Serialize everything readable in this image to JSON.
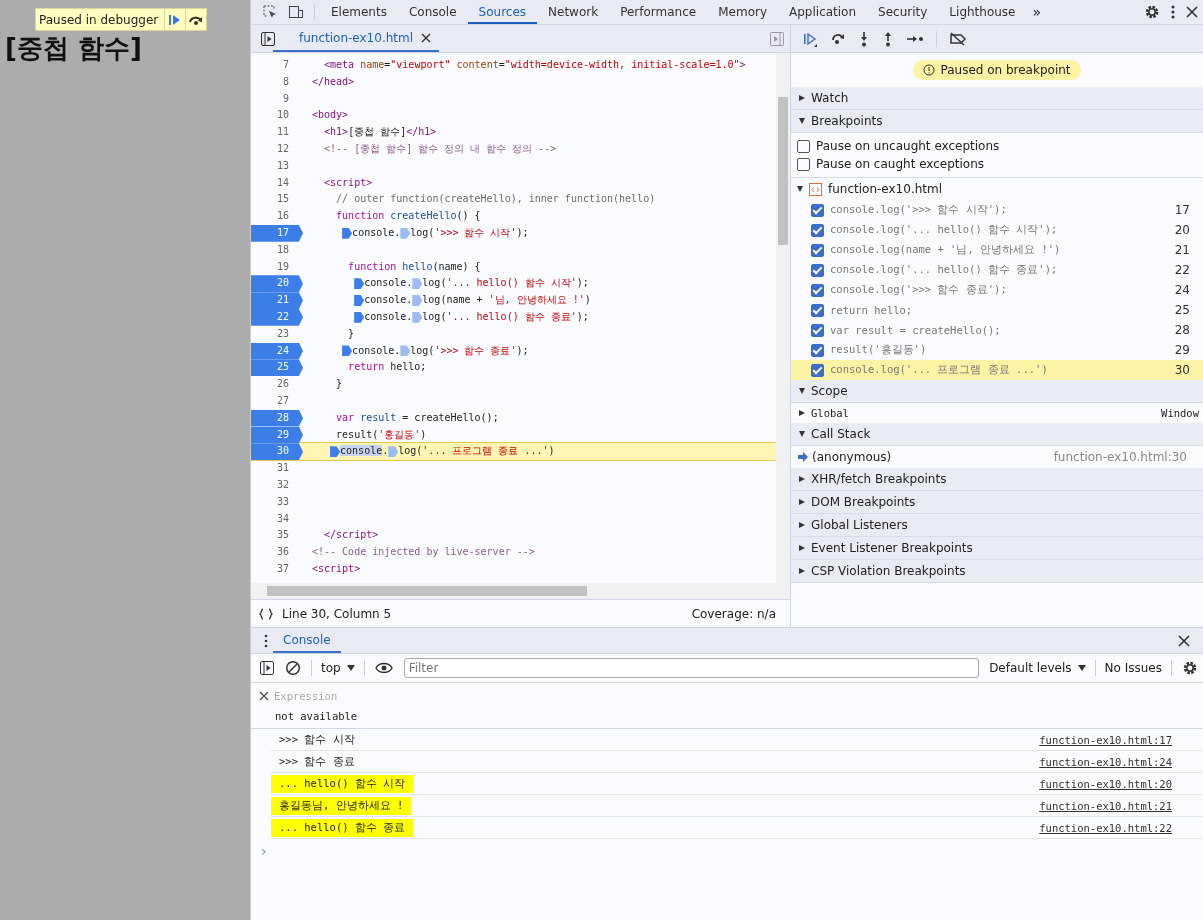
{
  "page": {
    "heading": "[중첩 함수]",
    "debugger_tooltip": {
      "label": "Paused in debugger"
    }
  },
  "devtools": {
    "tabs": [
      {
        "label": "Elements",
        "selected": false
      },
      {
        "label": "Console",
        "selected": false
      },
      {
        "label": "Sources",
        "selected": true
      },
      {
        "label": "Network",
        "selected": false
      },
      {
        "label": "Performance",
        "selected": false
      },
      {
        "label": "Memory",
        "selected": false
      },
      {
        "label": "Application",
        "selected": false
      },
      {
        "label": "Security",
        "selected": false
      },
      {
        "label": "Lighthouse",
        "selected": false
      }
    ],
    "more_tabs": "»",
    "editor": {
      "file_tab": {
        "label": "function-ex10.html",
        "selected": true
      },
      "lines": [
        {
          "number": "7",
          "breakpoint": false,
          "current": false,
          "segments": [
            {
              "kind": "tag",
              "text": "  <meta"
            },
            {
              "kind": "attr",
              "text": " name"
            },
            {
              "kind": "plain",
              "text": "="
            },
            {
              "kind": "str",
              "text": "\"viewport\""
            },
            {
              "kind": "attr",
              "text": " content"
            },
            {
              "kind": "plain",
              "text": "="
            },
            {
              "kind": "str",
              "text": "\"width=device-width, initial-scale=1.0\""
            },
            {
              "kind": "tag",
              "text": ">"
            }
          ]
        },
        {
          "number": "8",
          "breakpoint": false,
          "current": false,
          "segments": [
            {
              "kind": "tag",
              "text": "</head>"
            }
          ]
        },
        {
          "number": "9",
          "breakpoint": false,
          "current": false
        },
        {
          "number": "10",
          "breakpoint": false,
          "current": false,
          "segments": [
            {
              "kind": "tag",
              "text": "<body>"
            }
          ]
        },
        {
          "number": "11",
          "breakpoint": false,
          "current": false,
          "segments": [
            {
              "kind": "tag",
              "text": "  <h1>"
            },
            {
              "kind": "plain",
              "text": "[중첩 함수]"
            },
            {
              "kind": "tag",
              "text": "</h1>"
            }
          ]
        },
        {
          "number": "12",
          "breakpoint": false,
          "current": false,
          "segments": [
            {
              "kind": "cmt",
              "text": "  <!-- [중첩 함수] 함수 정의 내 함수 정의 -->"
            }
          ]
        },
        {
          "number": "13",
          "breakpoint": false,
          "current": false
        },
        {
          "number": "14",
          "breakpoint": false,
          "current": false,
          "segments": [
            {
              "kind": "tag",
              "text": "  <script>"
            }
          ]
        },
        {
          "number": "15",
          "breakpoint": false,
          "current": false,
          "segments": [
            {
              "kind": "jscmt",
              "text": "    // outer function(createHello), inner function(hello)"
            }
          ]
        },
        {
          "number": "16",
          "breakpoint": false,
          "current": false,
          "segments": [
            {
              "kind": "kw",
              "text": "    function"
            },
            {
              "kind": "def",
              "text": " createHello"
            },
            {
              "kind": "plain",
              "text": "() {"
            }
          ]
        },
        {
          "number": "17",
          "breakpoint": true,
          "current": false,
          "segments": [
            {
              "kind": "marker"
            },
            {
              "kind": "plain",
              "text": "     console."
            },
            {
              "kind": "marker-inactive"
            },
            {
              "kind": "plain",
              "text": "log("
            },
            {
              "kind": "str",
              "text": "'>>> 함수 시작'"
            },
            {
              "kind": "plain",
              "text": ");"
            }
          ]
        },
        {
          "number": "18",
          "breakpoint": false,
          "current": false
        },
        {
          "number": "19",
          "breakpoint": false,
          "current": false,
          "segments": [
            {
              "kind": "kw",
              "text": "      function"
            },
            {
              "kind": "def",
              "text": " hello"
            },
            {
              "kind": "plain",
              "text": "(name) {"
            }
          ]
        },
        {
          "number": "20",
          "breakpoint": true,
          "current": false,
          "segments": [
            {
              "kind": "marker"
            },
            {
              "kind": "plain",
              "text": "       console."
            },
            {
              "kind": "marker-inactive"
            },
            {
              "kind": "plain",
              "text": "log("
            },
            {
              "kind": "str",
              "text": "'... hello() 함수 시작'"
            },
            {
              "kind": "plain",
              "text": ");"
            }
          ]
        },
        {
          "number": "21",
          "breakpoint": true,
          "current": false,
          "segments": [
            {
              "kind": "marker"
            },
            {
              "kind": "plain",
              "text": "       console."
            },
            {
              "kind": "marker-inactive"
            },
            {
              "kind": "plain",
              "text": "log(name + "
            },
            {
              "kind": "str",
              "text": "'님, 안녕하세요 !'"
            },
            {
              "kind": "plain",
              "text": ")"
            }
          ]
        },
        {
          "number": "22",
          "breakpoint": true,
          "current": false,
          "segments": [
            {
              "kind": "marker"
            },
            {
              "kind": "plain",
              "text": "       console."
            },
            {
              "kind": "marker-inactive"
            },
            {
              "kind": "plain",
              "text": "log("
            },
            {
              "kind": "str",
              "text": "'... hello() 함수 종료'"
            },
            {
              "kind": "plain",
              "text": ");"
            }
          ]
        },
        {
          "number": "23",
          "breakpoint": false,
          "current": false,
          "segments": [
            {
              "kind": "plain",
              "text": "      }"
            }
          ]
        },
        {
          "number": "24",
          "breakpoint": true,
          "current": false,
          "segments": [
            {
              "kind": "marker"
            },
            {
              "kind": "plain",
              "text": "     console."
            },
            {
              "kind": "marker-inactive"
            },
            {
              "kind": "plain",
              "text": "log("
            },
            {
              "kind": "str",
              "text": "'>>> 함수 종료'"
            },
            {
              "kind": "plain",
              "text": ");"
            }
          ]
        },
        {
          "number": "25",
          "breakpoint": true,
          "current": false,
          "segments": [
            {
              "kind": "kw",
              "text": "      return"
            },
            {
              "kind": "plain",
              "text": " hello;"
            }
          ]
        },
        {
          "number": "26",
          "breakpoint": false,
          "current": false,
          "segments": [
            {
              "kind": "plain",
              "text": "    }"
            }
          ]
        },
        {
          "number": "27",
          "breakpoint": false,
          "current": false
        },
        {
          "number": "28",
          "breakpoint": true,
          "current": false,
          "segments": [
            {
              "kind": "kw",
              "text": "    var"
            },
            {
              "kind": "def",
              "text": " result"
            },
            {
              "kind": "plain",
              "text": " = createHello();"
            }
          ]
        },
        {
          "number": "29",
          "breakpoint": true,
          "current": false,
          "segments": [
            {
              "kind": "plain",
              "text": "    result("
            },
            {
              "kind": "str",
              "text": "'홍길동'"
            },
            {
              "kind": "plain",
              "text": ")"
            }
          ]
        },
        {
          "number": "30",
          "breakpoint": true,
          "current": true,
          "segments": [
            {
              "kind": "marker"
            },
            {
              "kind": "sel",
              "text": "   console"
            },
            {
              "kind": "plain",
              "text": "."
            },
            {
              "kind": "marker-inactive"
            },
            {
              "kind": "plain",
              "text": "log("
            },
            {
              "kind": "str",
              "text": "'... 프로그램 종료 ...'"
            },
            {
              "kind": "plain",
              "text": ")"
            }
          ]
        },
        {
          "number": "31",
          "breakpoint": false,
          "current": false
        },
        {
          "number": "32",
          "breakpoint": false,
          "current": false
        },
        {
          "number": "33",
          "breakpoint": false,
          "current": false
        },
        {
          "number": "34",
          "breakpoint": false,
          "current": false
        },
        {
          "number": "35",
          "breakpoint": false,
          "current": false,
          "segments": [
            {
              "kind": "tag",
              "text": "  </script>"
            }
          ]
        },
        {
          "number": "36",
          "breakpoint": false,
          "current": false,
          "segments": [
            {
              "kind": "cmt",
              "text": "<!-- Code injected by live-server -->"
            }
          ]
        },
        {
          "number": "37",
          "breakpoint": false,
          "current": false,
          "segments": [
            {
              "kind": "tag",
              "text": "<script>"
            }
          ]
        }
      ],
      "status": {
        "position": "Line 30, Column 5",
        "coverage": "Coverage: n/a"
      }
    },
    "sidebar": {
      "paused_banner": "Paused on breakpoint",
      "sections": [
        {
          "title": "Watch",
          "expanded": false
        },
        {
          "kind": "breakpoints",
          "title": "Breakpoints",
          "expanded": true,
          "options": [
            {
              "label": "Pause on uncaught exceptions",
              "checked": false
            },
            {
              "label": "Pause on caught exceptions",
              "checked": false
            }
          ],
          "file": {
            "name": "function-ex10.html",
            "expanded": true
          },
          "items": [
            {
              "code": "console.log('>>> 함수 시작');",
              "line": "17",
              "checked": true,
              "selected": false
            },
            {
              "code": "console.log('... hello() 함수 시작');",
              "line": "20",
              "checked": true,
              "selected": false
            },
            {
              "code": "console.log(name + '님, 안녕하세요 !')",
              "line": "21",
              "checked": true,
              "selected": false
            },
            {
              "code": "console.log('... hello() 함수 종료');",
              "line": "22",
              "checked": true,
              "selected": false
            },
            {
              "code": "console.log('>>> 함수 종료');",
              "line": "24",
              "checked": true,
              "selected": false
            },
            {
              "code": "return hello;",
              "line": "25",
              "checked": true,
              "selected": false
            },
            {
              "code": "var result = createHello();",
              "line": "28",
              "checked": true,
              "selected": false
            },
            {
              "code": "result('홍길동')",
              "line": "29",
              "checked": true,
              "selected": false
            },
            {
              "code": "console.log('... 프로그램 종료 ...')",
              "line": "30",
              "checked": true,
              "selected": true
            }
          ]
        },
        {
          "kind": "scope",
          "title": "Scope",
          "expanded": true,
          "entries": [
            {
              "name": "Global",
              "value": "Window",
              "expanded": false
            }
          ]
        },
        {
          "kind": "callstack",
          "title": "Call Stack",
          "expanded": true,
          "frames": [
            {
              "name": "(anonymous)",
              "location": "function-ex10.html:30",
              "selected": true
            }
          ]
        },
        {
          "title": "XHR/fetch Breakpoints",
          "expanded": false
        },
        {
          "title": "DOM Breakpoints",
          "expanded": false
        },
        {
          "title": "Global Listeners",
          "expanded": false
        },
        {
          "title": "Event Listener Breakpoints",
          "expanded": false
        },
        {
          "title": "CSP Violation Breakpoints",
          "expanded": false
        }
      ]
    },
    "drawer": {
      "tab": {
        "label": "Console",
        "selected": true
      },
      "context": "top",
      "filter": {
        "placeholder": "Filter"
      },
      "levels": "Default levels",
      "issues": "No Issues",
      "expression": {
        "placeholder": "Expression",
        "value": "not available"
      },
      "messages": [
        {
          "text": ">>> 함수 시작",
          "source": "function-ex10.html:17",
          "highlighted": false
        },
        {
          "text": ">>> 함수 종료",
          "source": "function-ex10.html:24",
          "highlighted": false
        },
        {
          "text": "... hello() 함수 시작",
          "source": "function-ex10.html:20",
          "highlighted": true
        },
        {
          "text": "홍길동님, 안녕하세요 !",
          "source": "function-ex10.html:21",
          "highlighted": true
        },
        {
          "text": "... hello() 함수 종료",
          "source": "function-ex10.html:22",
          "highlighted": true
        }
      ],
      "prompt": "›"
    }
  }
}
